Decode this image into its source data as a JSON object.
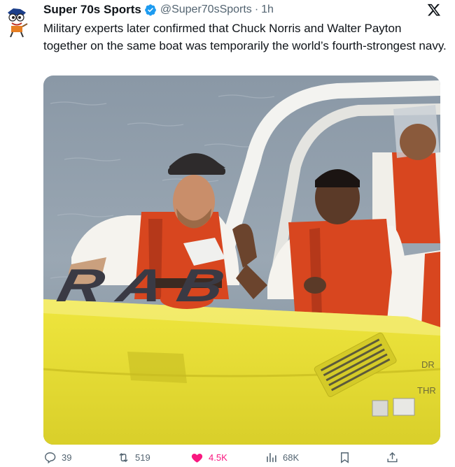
{
  "tweet": {
    "author_name": "Super 70s Sports",
    "handle": "@Super70sSports",
    "separator": "·",
    "time": "1h",
    "text": "Military experts later confirmed that Chuck Norris and Walter Payton together on the same boat was temporarily the world’s fourth-strongest navy.",
    "boat_lettering": "ARAB",
    "boat_side_text": [
      "DR",
      "THR"
    ]
  },
  "actions": {
    "replies": "39",
    "reposts": "519",
    "likes": "4.5K",
    "views": "68K"
  },
  "icons": [
    "avatar",
    "verified-badge-icon",
    "x-logo-icon",
    "reply-icon",
    "repost-icon",
    "heart-icon",
    "views-icon",
    "bookmark-icon",
    "share-icon"
  ],
  "colors": {
    "verified": "#1d9bf0",
    "like": "#f91880",
    "muted": "#536471",
    "boat_yellow": "#e9e035",
    "vest_red": "#d8461f"
  }
}
